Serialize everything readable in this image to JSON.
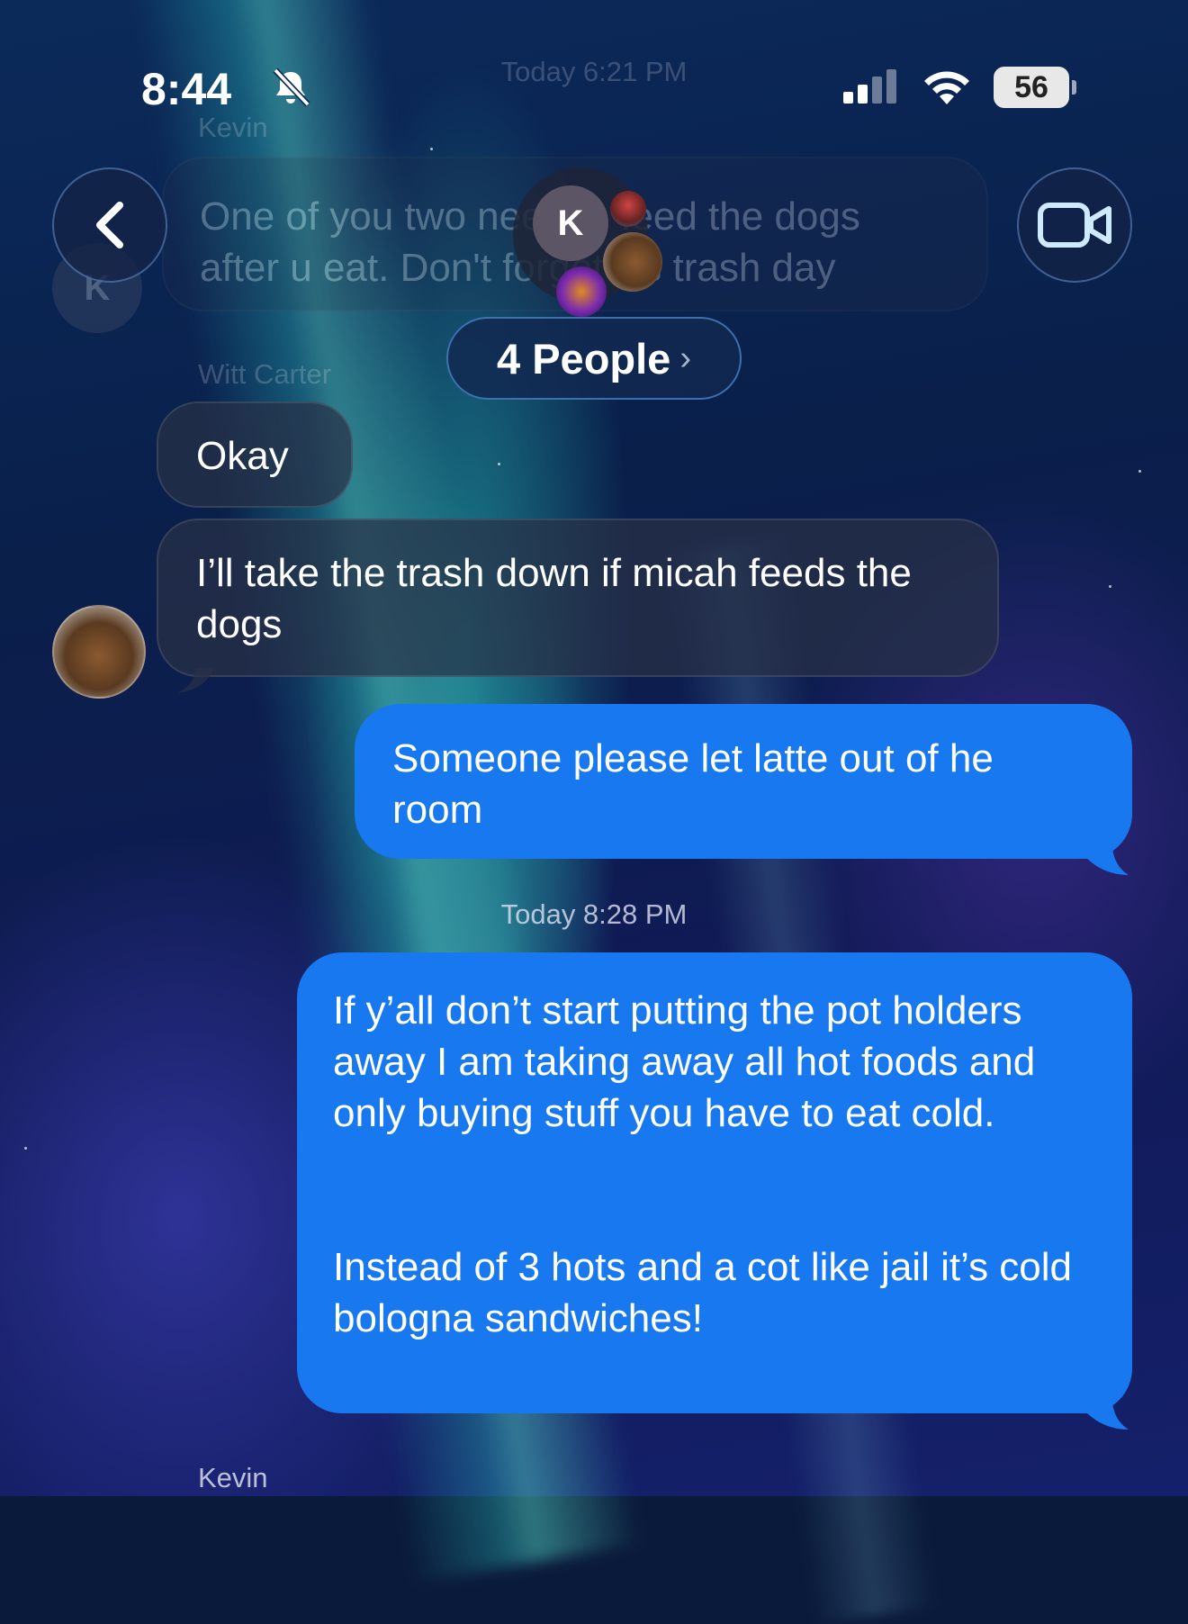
{
  "status_bar": {
    "time": "8:44",
    "battery": "56"
  },
  "header": {
    "group_label": "4 People",
    "cluster_initial": "K"
  },
  "conversation": {
    "top_timestamp": "Today 6:21 PM",
    "sender_kevin_top": "Kevin",
    "kevin_avatar_initial": "K",
    "kevin_msg_line1": "One of you two need to feed the dogs",
    "kevin_msg_line2": "after u eat. Don't forget it's trash day",
    "sender_witt": "Witt Carter",
    "witt_msg_1": "Okay",
    "witt_msg_2": "I’ll take the trash down if micah feeds the dogs",
    "me_msg_1": "Someone please let latte out of he room",
    "mid_timestamp": "Today 8:28 PM",
    "me_msg_2_para1": "If y’all don’t start putting the pot holders away I am taking away all hot foods and only buying stuff you have to eat cold.",
    "me_msg_2_para2": "Instead of 3 hots and a cot like jail it’s cold bologna sandwiches!",
    "sender_kevin_bottom": "Kevin"
  },
  "colors": {
    "outgoing_bubble": "#1778ef",
    "incoming_bubble": "#28304a"
  },
  "icons": [
    "bell-slash-icon",
    "cellular-signal-icon",
    "wifi-icon",
    "battery-icon",
    "back-chevron-icon",
    "video-camera-icon",
    "chevron-right-icon"
  ]
}
